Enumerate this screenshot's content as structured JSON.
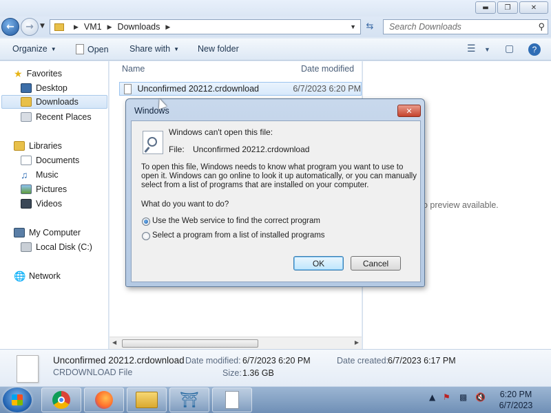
{
  "window": {
    "controls": [
      "minimize",
      "maximize",
      "close"
    ]
  },
  "address": {
    "path": [
      "VM1",
      "Downloads"
    ],
    "search_placeholder": "Search Downloads"
  },
  "toolbar": {
    "organize": "Organize",
    "open": "Open",
    "share_with": "Share with",
    "new_folder": "New folder"
  },
  "nav": {
    "favorites": "Favorites",
    "desktop": "Desktop",
    "downloads": "Downloads",
    "recent_places": "Recent Places",
    "libraries": "Libraries",
    "documents": "Documents",
    "music": "Music",
    "pictures": "Pictures",
    "videos": "Videos",
    "my_computer": "My Computer",
    "local_disk": "Local Disk (C:)",
    "network": "Network"
  },
  "filelist": {
    "col_name": "Name",
    "col_date": "Date modified",
    "file_name": "Unconfirmed 20212.crdownload",
    "file_date": "6/7/2023 6:20 PM"
  },
  "preview": {
    "text": "o preview available."
  },
  "details": {
    "name": "Unconfirmed 20212.crdownload",
    "type": "CRDOWNLOAD File",
    "date_modified_label": "Date modified:",
    "date_modified": "6/7/2023 6:20 PM",
    "size_label": "Size:",
    "size": "1.36 GB",
    "date_created_label": "Date created:",
    "date_created": "6/7/2023 6:17 PM"
  },
  "dialog": {
    "title": "Windows",
    "heading": "Windows can't open this file:",
    "file_label": "File:",
    "file_value": "Unconfirmed 20212.crdownload",
    "para1": "To open this file, Windows needs to know what program you want to use to",
    "para2": "open it. Windows can go online to look it up automatically, or you can manually",
    "para3": "select from a list of programs that are installed on your computer.",
    "question": "What do you want to do?",
    "option1": "Use the Web service to find the correct program",
    "option2": "Select a program from a list of installed programs",
    "selected_option": 1,
    "ok": "OK",
    "cancel": "Cancel"
  },
  "taskbar": {
    "time": "6:20 PM",
    "date": "6/7/2023",
    "apps": [
      "chrome",
      "firefox",
      "file-explorer",
      "mysql-workbench",
      "blank-document"
    ]
  }
}
